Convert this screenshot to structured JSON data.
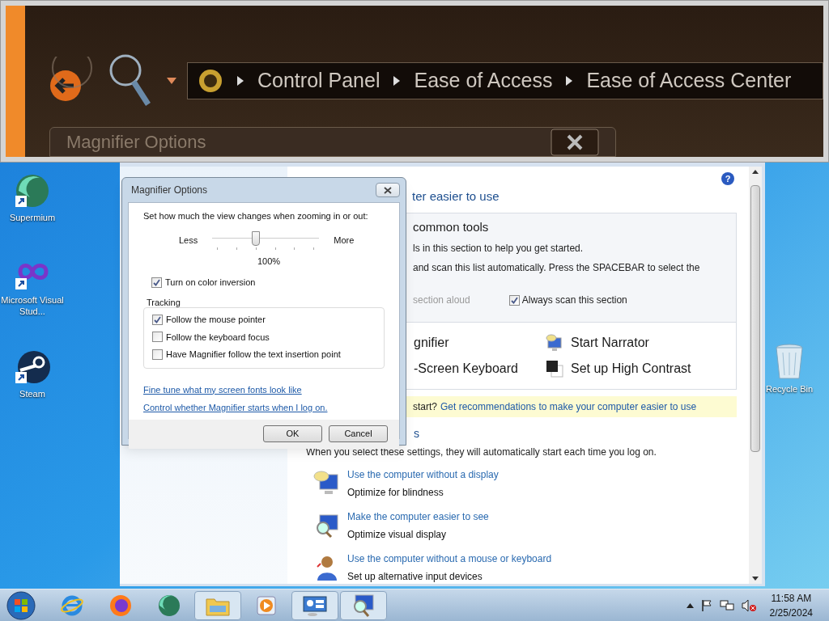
{
  "magnifier_view": {
    "breadcrumb": [
      "Control Panel",
      "Ease of Access",
      "Ease of Access Center"
    ],
    "dialog_title": "Magnifier Options"
  },
  "desktop_icons_left": [
    {
      "label": "Supermium"
    },
    {
      "label": "Microsoft Visual Stud..."
    },
    {
      "label": "Steam"
    }
  ],
  "desktop_icons_right": [
    {
      "label": "Recycle Bin"
    }
  ],
  "control_panel": {
    "help": "?",
    "title": "ter easier to use",
    "common_tools": {
      "heading": "common tools",
      "lines": [
        "ls in this section to help you get started.",
        "and scan this list automatically.  Press the SPACEBAR to select the"
      ],
      "read_aloud": {
        "label": "section aloud",
        "disabled": true
      },
      "always_scan": {
        "label": "Always scan this section",
        "checked": true
      }
    },
    "tools": [
      "gnifier",
      "Start Narrator",
      "-Screen Keyboard",
      "Set up High Contrast"
    ],
    "tip": {
      "text": "start?",
      "link": "Get recommendations to make your computer easier to use"
    },
    "section_heading": "s",
    "section_intro": "When you select these settings, they will automatically start each time you log on.",
    "items": [
      {
        "link": "Use the computer without a display",
        "description": "Optimize for blindness"
      },
      {
        "link": "Make the computer easier to see",
        "description": "Optimize visual display"
      },
      {
        "link": "Use the computer without a mouse or keyboard",
        "description": "Set up alternative input devices"
      }
    ]
  },
  "dialog": {
    "title": "Magnifier Options",
    "prompt": "Set how much the view changes when zooming in or out:",
    "slider": {
      "less": "Less",
      "more": "More",
      "level": 0.41,
      "reading": "100%"
    },
    "color_inversion": {
      "label": "Turn on color inversion",
      "checked": true
    },
    "tracking": {
      "title": "Tracking",
      "options": [
        {
          "label": "Follow the mouse pointer",
          "checked": true
        },
        {
          "label": "Follow the keyboard focus",
          "checked": false
        },
        {
          "label": "Have Magnifier follow the text insertion point",
          "checked": false
        }
      ]
    },
    "links": [
      "Fine tune what my screen fonts look like",
      "Control whether Magnifier starts when I log on."
    ],
    "buttons": [
      "OK",
      "Cancel"
    ]
  },
  "taskbar": {
    "time": "11:58 AM",
    "date": "2/25/2024"
  }
}
